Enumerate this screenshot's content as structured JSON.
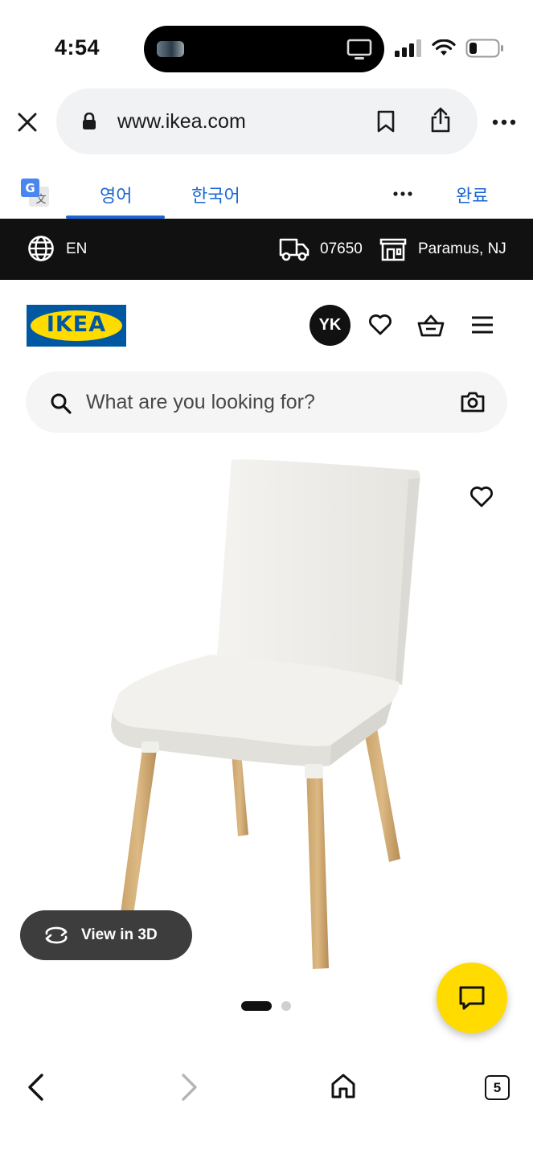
{
  "status_bar": {
    "time": "4:54"
  },
  "browser": {
    "url": "www.ikea.com"
  },
  "translate_bar": {
    "tabs": [
      {
        "label": "영어",
        "active": true
      },
      {
        "label": "한국어",
        "active": false
      }
    ],
    "done_label": "완료"
  },
  "utility_bar": {
    "language": "EN",
    "zip": "07650",
    "store": "Paramus, NJ"
  },
  "header": {
    "logo_text": "IKEA",
    "avatar_initials": "YK"
  },
  "search": {
    "placeholder": "What are you looking for?"
  },
  "product": {
    "view3d_label": "View in 3D",
    "carousel": {
      "count": 2,
      "active_index": 0
    }
  },
  "bottom_toolbar": {
    "tab_count": "5"
  },
  "colors": {
    "ikea_blue": "#0058a3",
    "ikea_yellow": "#ffdb00",
    "translate_blue": "#1a66d2",
    "util_bar_bg": "#111111"
  }
}
